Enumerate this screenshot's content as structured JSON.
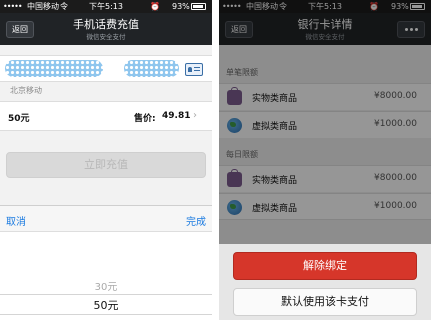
{
  "left_screen": {
    "status_bar": {
      "signal": "•••••",
      "carrier": "中国移动",
      "wifi": "令",
      "time": "下午5:13",
      "alarm": "⏰",
      "battery": "93%"
    },
    "nav": {
      "back_label": "返回",
      "title": "手机话费充值",
      "subtitle": "微信安全支付"
    },
    "carrier_label": "北京移动",
    "amount_row": {
      "amount": "50元",
      "price_label": "售价:",
      "price_value": "49.81",
      "chevron": "›"
    },
    "recharge_button": "立即充值",
    "picker": {
      "cancel": "取消",
      "done": "完成",
      "options_above": "30元",
      "selected": "50元"
    }
  },
  "right_screen": {
    "status_bar": {
      "signal": "•••••",
      "carrier": "中国移动",
      "wifi": "令",
      "time": "下午5:13",
      "alarm": "⏰",
      "battery": "93%"
    },
    "nav": {
      "back_label": "返回",
      "title": "银行卡详情",
      "subtitle": "微信安全支付"
    },
    "sections": [
      {
        "header": "单笔限额",
        "rows": [
          {
            "icon": "shopping-bag-icon",
            "name": "实物类商品",
            "amount": "¥8000.00"
          },
          {
            "icon": "globe-icon",
            "name": "虚拟类商品",
            "amount": "¥1000.00"
          }
        ]
      },
      {
        "header": "每日限额",
        "rows": [
          {
            "icon": "shopping-bag-icon",
            "name": "实物类商品",
            "amount": "¥8000.00"
          },
          {
            "icon": "globe-icon",
            "name": "虚拟类商品",
            "amount": "¥1000.00"
          }
        ]
      }
    ],
    "action_sheet": {
      "unbind": "解除绑定",
      "default_pay": "默认使用该卡支付"
    }
  },
  "colors": {
    "nav_bg": "#202326",
    "link_blue": "#1a7ae0",
    "danger_red": "#d6362a",
    "disabled_gray": "#d9d9d9"
  }
}
